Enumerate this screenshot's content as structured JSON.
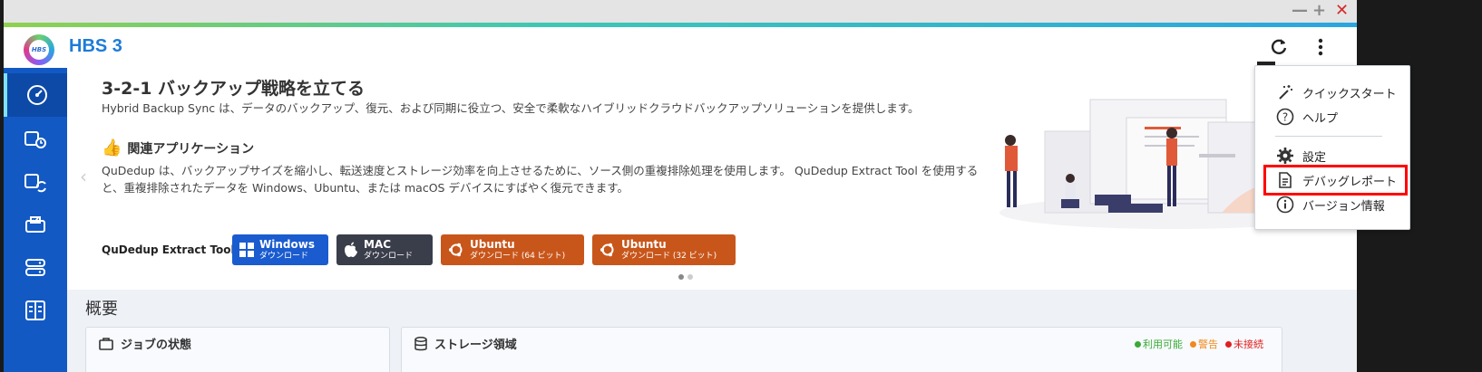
{
  "window": {
    "minimize": "—",
    "maximize": "+",
    "close": "✕"
  },
  "header": {
    "logo_text": "HBS",
    "title": "HBS 3"
  },
  "sidebar": {
    "items": [
      {
        "icon": "dashboard-icon"
      },
      {
        "icon": "backup-restore-icon"
      },
      {
        "icon": "sync-icon"
      },
      {
        "icon": "jobs-icon"
      },
      {
        "icon": "storage-icon"
      },
      {
        "icon": "services-icon"
      }
    ]
  },
  "banner": {
    "title": "3-2-1 バックアップ戦略を立てる",
    "description": "Hybrid Backup Sync は、データのバックアップ、復元、および同期に役立つ、安全で柔軟なハイブリッドクラウドバックアップソリューションを提供します。",
    "related_icon": "👍",
    "related_title": "関連アプリケーション",
    "related_desc": "QuDedup は、バックアップサイズを縮小し、転送速度とストレージ効率を向上させるために、ソース側の重複排除処理を使用します。 QuDedup Extract Tool を使用すると、重複排除されたデータを Windows、Ubuntu、または macOS デバイスにすばやく復元できます。",
    "tool_label": "QuDedup Extract Tool:",
    "downloads": [
      {
        "name": "Windows",
        "sub": "ダウンロード"
      },
      {
        "name": "MAC",
        "sub": "ダウンロード"
      },
      {
        "name": "Ubuntu",
        "sub": "ダウンロード (64 ビット)"
      },
      {
        "name": "Ubuntu",
        "sub": "ダウンロード (32 ビット)"
      }
    ],
    "prev": "‹"
  },
  "overview": {
    "title": "概要",
    "job_card": "ジョブの状態",
    "storage_card": "ストレージ領域",
    "legend": [
      {
        "label": "利用可能",
        "color": "#3aaa35"
      },
      {
        "label": "警告",
        "color": "#f08a1c"
      },
      {
        "label": "未接続",
        "color": "#e02020"
      }
    ]
  },
  "menu": {
    "items": [
      {
        "label": "クイックスタート",
        "icon": "magic-wand-icon"
      },
      {
        "label": "ヘルプ",
        "icon": "help-circle-icon"
      },
      {
        "label": "設定",
        "icon": "gear-icon"
      },
      {
        "label": "デバッグレポート",
        "icon": "document-icon"
      },
      {
        "label": "バージョン情報",
        "icon": "info-circle-icon"
      }
    ]
  },
  "colors": {
    "brand": "#1e7bd8",
    "sidebar": "#1259c3",
    "windows": "#1a5ccf",
    "mac": "#3a3d4a",
    "ubuntu": "#c8561b",
    "highlight": "#ff0000"
  }
}
